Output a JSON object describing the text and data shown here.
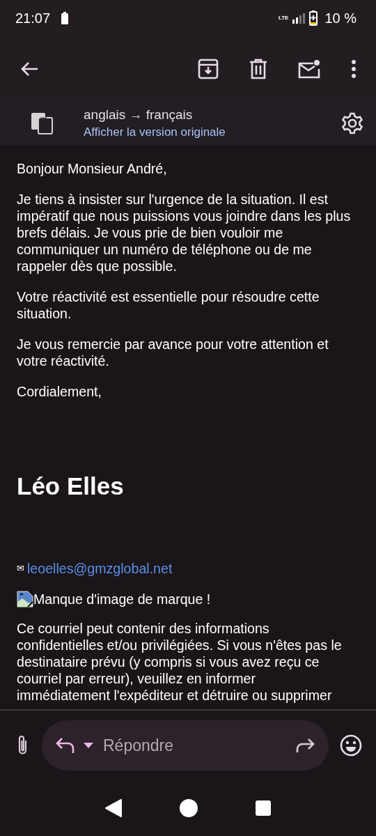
{
  "status_bar": {
    "time": "21:07",
    "network": "LTE",
    "battery": "10 %"
  },
  "translation": {
    "languages": "anglais → français",
    "link": "Afficher la version originale"
  },
  "body": {
    "greeting": "Bonjour Monsieur André,",
    "paragraphs": [
      "Je tiens à insister sur l'urgence de la situation. Il est impératif que nous puissions vous joindre dans les plus brefs délais. Je vous prie de bien vouloir me communiquer un numéro de téléphone ou de me rappeler dès que possible.",
      "Votre réactivité est essentielle pour résoudre cette situation.",
      "Je vous remercie par avance pour votre attention et votre réactivité."
    ],
    "closing": "Cordialement,",
    "signature": {
      "name": "Léo Elles",
      "email_symbol": "✉",
      "email": "leoelles@gmzglobal.net",
      "image_alt": "Manque d'image de marque !"
    },
    "disclaimer": "Ce courriel peut contenir des informations confidentielles et/ou privilégiées. Si vous n'êtes pas le destinataire prévu (y compris si vous avez reçu ce courriel par erreur), veuillez en informer immédiatement l'expéditeur et détruire ou supprimer"
  },
  "reply_bar": {
    "placeholder": "Répondre"
  }
}
